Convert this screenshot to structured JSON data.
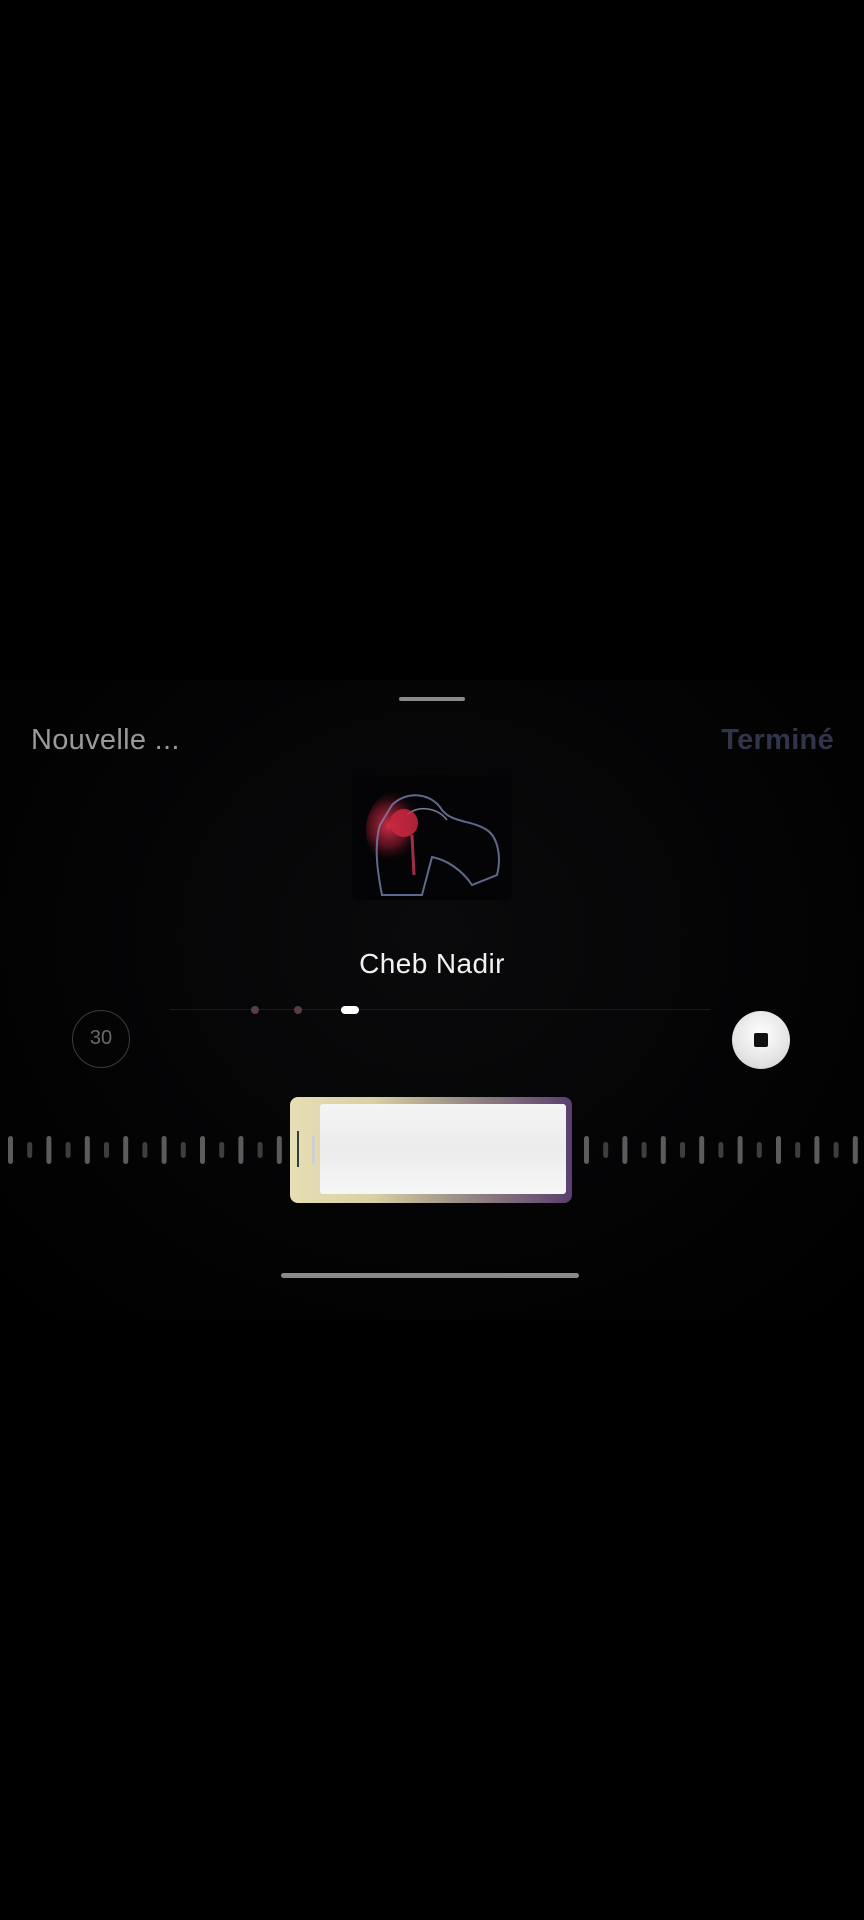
{
  "header": {
    "left_label": "Nouvelle ...",
    "right_label": "Terminé"
  },
  "track": {
    "artist": "Cheb Nadir",
    "artwork_icon": "album-artwork"
  },
  "pager": {
    "count": 3,
    "active_index": 2
  },
  "controls": {
    "skip_label": "30",
    "skip_icon": "skip-30-icon",
    "stop_icon": "stop-icon"
  },
  "colors": {
    "background": "#000000",
    "accent_done": "#30354a",
    "selector_gold": "#e7dfb4",
    "selector_purple": "#5a3e6e"
  }
}
